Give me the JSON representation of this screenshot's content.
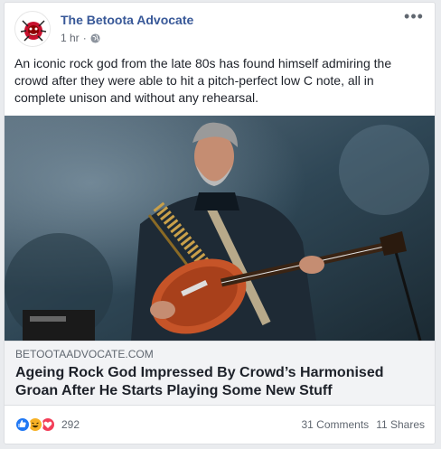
{
  "post": {
    "page_name": "The Betoota Advocate",
    "time": "1 hr",
    "privacy_icon": "globe-icon",
    "body": "An iconic rock god from the late 80s has found himself admiring the crowd after they were able to hit a pitch-perfect low C note, all in complete unison and without any rehearsal."
  },
  "link": {
    "domain": "BETOOTAADVOCATE.COM",
    "headline": "Ageing Rock God Impressed By Crowd’s Harmonised Groan After He Starts Playing Some New Stuff"
  },
  "engagement": {
    "reaction_icons": [
      "like-icon",
      "haha-icon",
      "love-icon"
    ],
    "reaction_count": "292",
    "comments": "31 Comments",
    "shares": "11 Shares"
  },
  "colors": {
    "brand_blue": "#385898",
    "like": "#2078f4",
    "haha": "#f7b125",
    "love": "#f33e58"
  }
}
